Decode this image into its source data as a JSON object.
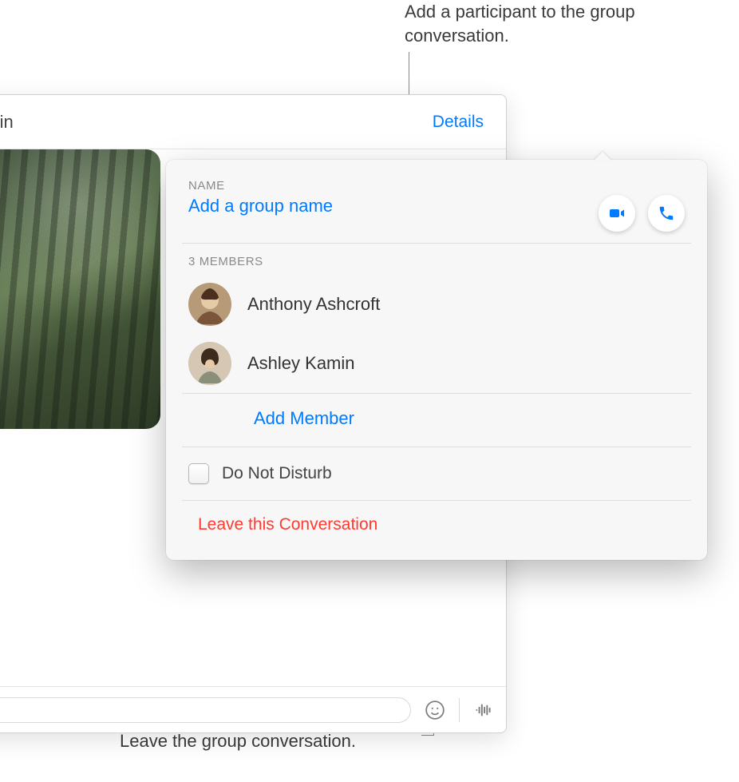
{
  "callouts": {
    "top": "Add a participant to the group conversation.",
    "bottom": "Leave the group conversation."
  },
  "chat": {
    "title_visible_fragment": "ft, Ashley Kamin",
    "details_label": "Details"
  },
  "popover": {
    "name_label": "NAME",
    "group_name_placeholder": "Add a group name",
    "members_count_label": "3 MEMBERS",
    "members": [
      {
        "name": "Anthony Ashcroft"
      },
      {
        "name": "Ashley Kamin"
      }
    ],
    "add_member_label": "Add Member",
    "dnd_label": "Do Not Disturb",
    "leave_label": "Leave this Conversation"
  },
  "colors": {
    "accent": "#007aff",
    "destructive": "#ff3b30"
  }
}
